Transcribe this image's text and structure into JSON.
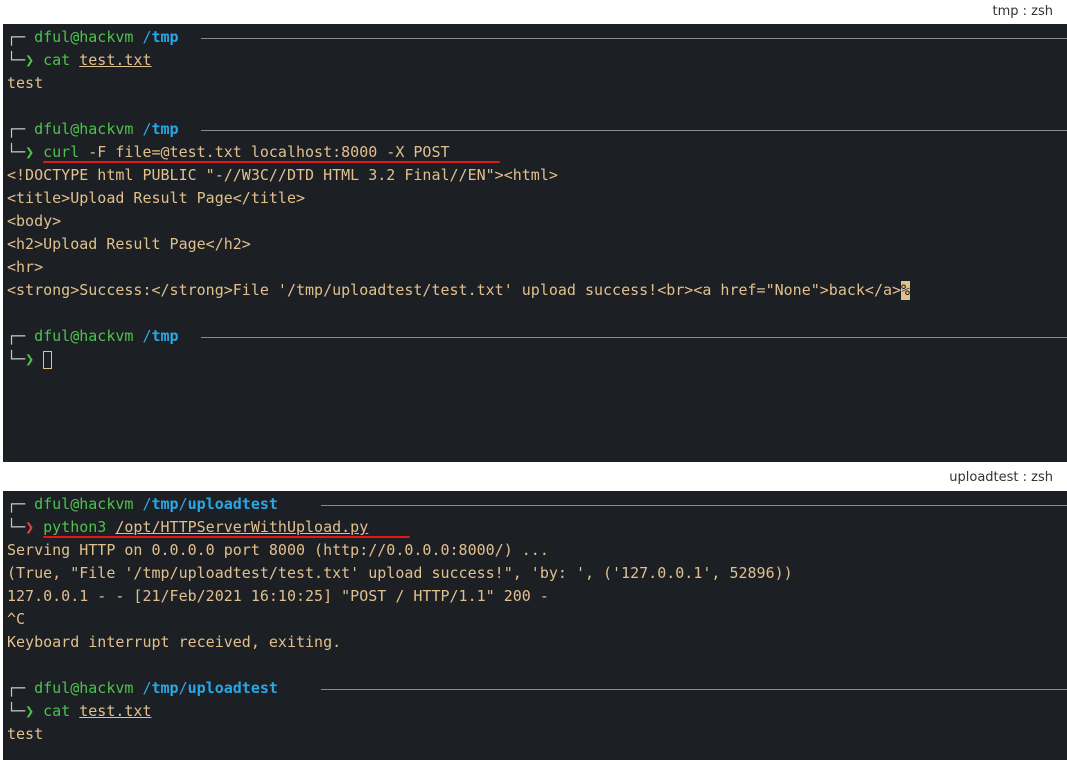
{
  "top_pane": {
    "title": "tmp : zsh",
    "prompts": [
      {
        "user": "dful@hackvm",
        "dir_prefix": "/",
        "dir": "tmp",
        "cmd": "cat",
        "arg": "test.txt",
        "output": [
          "test"
        ]
      },
      {
        "user": "dful@hackvm",
        "dir_prefix": "/",
        "dir": "tmp",
        "cmd": "curl",
        "arg": "-F file=@test.txt localhost:8000 -X POST",
        "output": [
          "<!DOCTYPE html PUBLIC \"-//W3C//DTD HTML 3.2 Final//EN\"><html>",
          "<title>Upload Result Page</title>",
          "<body>",
          "<h2>Upload Result Page</h2>",
          "<hr>",
          "<strong>Success:</strong>File '/tmp/uploadtest/test.txt' upload success!<br><a href=\"None\">back</a>"
        ],
        "no_eol_marker": "%"
      },
      {
        "user": "dful@hackvm",
        "dir_prefix": "/",
        "dir": "tmp"
      }
    ]
  },
  "bottom_pane": {
    "title": "uploadtest : zsh",
    "prompts": [
      {
        "user": "dful@hackvm",
        "dir_prefix": "/",
        "dir1": "tmp",
        "dir_sep": "/",
        "dir2": "uploadtest",
        "cmd": "python3",
        "arg": "/opt/HTTPServerWithUpload.py",
        "output": [
          "Serving HTTP on 0.0.0.0 port 8000 (http://0.0.0.0:8000/) ...",
          "(True, \"File '/tmp/uploadtest/test.txt' upload success!\", 'by: ', ('127.0.0.1', 52896))",
          "127.0.0.1 - - [21/Feb/2021 16:10:25] \"POST / HTTP/1.1\" 200 -",
          "^C",
          "Keyboard interrupt received, exiting."
        ]
      },
      {
        "user": "dful@hackvm",
        "dir_prefix": "/",
        "dir1": "tmp",
        "dir_sep": "/",
        "dir2": "uploadtest",
        "cmd": "cat",
        "arg": "test.txt",
        "output": [
          "test"
        ]
      }
    ]
  },
  "glyphs": {
    "frame_top": "┌─ ",
    "frame_bottom": "└─",
    "prompt_arrow": "❯"
  },
  "colors": {
    "background": "#1c1f23",
    "user": "#4ec24e",
    "path": "#2aa7e6",
    "output": "#e2c08d",
    "error_arrow": "#e04848",
    "highlight": "#e01818"
  }
}
